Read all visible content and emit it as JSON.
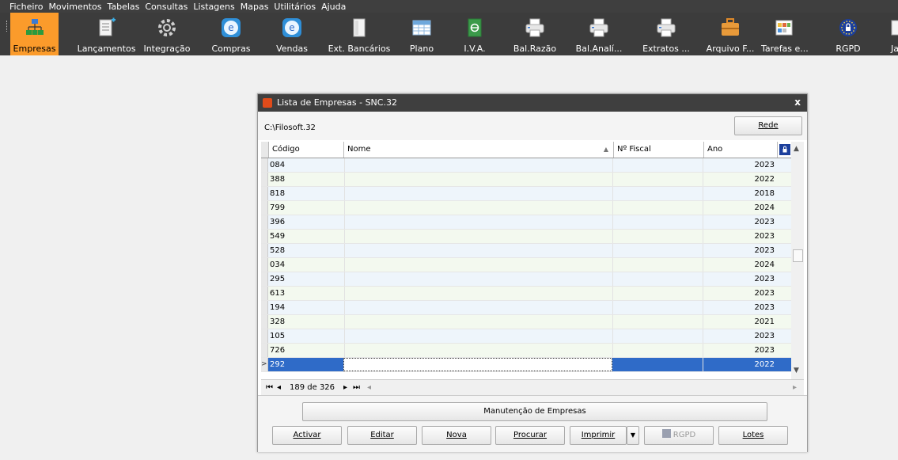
{
  "menubar": [
    "Ficheiro",
    "Movimentos",
    "Tabelas",
    "Consultas",
    "Listagens",
    "Mapas",
    "Utilitários",
    "Ajuda"
  ],
  "toolbar": [
    {
      "label": "Empresas",
      "icon": "companies-icon",
      "active": true
    },
    {
      "label": "Lançamentos",
      "icon": "entries-icon"
    },
    {
      "label": "Integração",
      "icon": "integration-gear-icon"
    },
    {
      "label": "Compras",
      "icon": "purchases-e-icon"
    },
    {
      "label": "Vendas",
      "icon": "sales-e-icon"
    },
    {
      "label": "Ext. Bancários",
      "icon": "bank-statement-icon"
    },
    {
      "label": "Plano",
      "icon": "chart-of-accounts-grid-icon"
    },
    {
      "label": "I.V.A.",
      "icon": "vat-book-icon"
    },
    {
      "label": "Bal.Razão",
      "icon": "printer-icon"
    },
    {
      "label": "Bal.Analí...",
      "icon": "printer-icon"
    },
    {
      "label": "Extratos ...",
      "icon": "printer-icon"
    },
    {
      "label": "Arquivo F...",
      "icon": "archive-briefcase-icon"
    },
    {
      "label": "Tarefas e...",
      "icon": "tasks-calendar-icon"
    },
    {
      "label": "RGPD",
      "icon": "rgpd-shield-icon"
    },
    {
      "label": "Ja",
      "icon": "window-icon"
    }
  ],
  "dialog": {
    "title": "Lista de Empresas - SNC.32",
    "close": "x",
    "path": "C:\\Filosoft.32",
    "rede_button": "Rede",
    "columns": {
      "codigo": "Código",
      "nome": "Nome",
      "nif": "Nº Fiscal",
      "ano": "Ano"
    },
    "rows": [
      {
        "codigo": "084",
        "ano": "2023"
      },
      {
        "codigo": "388",
        "ano": "2022"
      },
      {
        "codigo": "818",
        "ano": "2018"
      },
      {
        "codigo": "799",
        "ano": "2024"
      },
      {
        "codigo": "396",
        "ano": "2023"
      },
      {
        "codigo": "549",
        "ano": "2023"
      },
      {
        "codigo": "528",
        "ano": "2023"
      },
      {
        "codigo": "034",
        "ano": "2024"
      },
      {
        "codigo": "295",
        "ano": "2023"
      },
      {
        "codigo": "613",
        "ano": "2023"
      },
      {
        "codigo": "194",
        "ano": "2023"
      },
      {
        "codigo": "328",
        "ano": "2021"
      },
      {
        "codigo": "105",
        "ano": "2023"
      },
      {
        "codigo": "726",
        "ano": "2023"
      },
      {
        "codigo": "292",
        "ano": "2022",
        "selected": true
      }
    ],
    "navigator": "189 de 326",
    "manutencao_button": "Manutenção de Empresas",
    "buttons": {
      "activar": "Activar",
      "editar": "Editar",
      "nova": "Nova",
      "procurar": "Procurar",
      "imprimir": "Imprimir",
      "rgpd": "RGPD",
      "lotes": "Lotes"
    }
  },
  "colors": {
    "accent": "#fb9b2b",
    "selection": "#2f6bc8",
    "titlebar": "#3f3f3f"
  }
}
